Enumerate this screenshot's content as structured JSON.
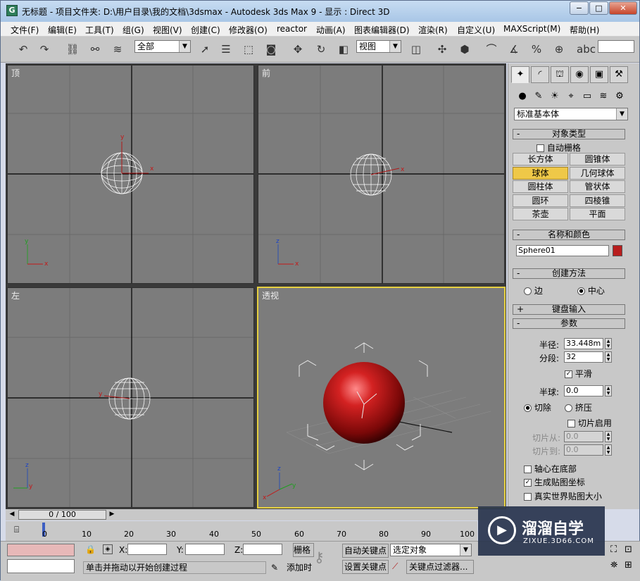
{
  "window": {
    "title": "无标题    - 项目文件夹: D:\\用户目录\\我的文档\\3dsmax      - Autodesk 3ds Max 9      - 显示 : Direct 3D",
    "controls": [
      "−",
      "□",
      "✕"
    ]
  },
  "menubar": {
    "items": [
      "文件(F)",
      "编辑(E)",
      "工具(T)",
      "组(G)",
      "视图(V)",
      "创建(C)",
      "修改器(O)",
      "reactor",
      "动画(A)",
      "图表编辑器(D)",
      "渲染(R)",
      "自定义(U)",
      "MAXScript(M)",
      "帮助(H)"
    ]
  },
  "toolbar": {
    "selection_filter": "全部",
    "reference_coord": "视图",
    "named_selection_placeholder": ""
  },
  "viewports": {
    "top": {
      "label": "顶",
      "axis_labels": {
        "x": "x",
        "y": "y"
      }
    },
    "front": {
      "label": "前",
      "axis_labels": {
        "x": "x",
        "z": "z"
      }
    },
    "left": {
      "label": "左",
      "axis_labels": {
        "y": "y",
        "z": "z"
      }
    },
    "perspective": {
      "label": "透视",
      "active": true,
      "axis_labels": {
        "x": "x",
        "y": "y",
        "z": "z"
      }
    }
  },
  "command_panel": {
    "category_dropdown": "标准基本体",
    "rollouts": {
      "object_type": {
        "title": "对象类型",
        "autogrid_label": "自动栅格",
        "buttons": [
          "长方体",
          "圆锥体",
          "球体",
          "几何球体",
          "圆柱体",
          "管状体",
          "圆环",
          "四棱锥",
          "茶壶",
          "平面"
        ],
        "active_button": "球体"
      },
      "name_color": {
        "title": "名称和颜色",
        "name": "Sphere01",
        "color": "#b81d1d"
      },
      "creation_method": {
        "title": "创建方法",
        "option_edge": "边",
        "option_center": "中心",
        "selected": "中心"
      },
      "keyboard_entry": {
        "title": "键盘输入"
      },
      "parameters": {
        "title": "参数",
        "radius_label": "半径:",
        "radius_value": "33.448m",
        "segments_label": "分段:",
        "segments_value": "32",
        "smooth_label": "平滑",
        "smooth_checked": true,
        "hemisphere_label": "半球:",
        "hemisphere_value": "0.0",
        "chop_label": "切除",
        "squash_label": "挤压",
        "slice_on_label": "切片启用",
        "slice_from_label": "切片从:",
        "slice_from_value": "0.0",
        "slice_to_label": "切片到:",
        "slice_to_value": "0.0",
        "base_to_pivot_label": "轴心在底部",
        "gen_mapping_label": "生成贴图坐标",
        "gen_mapping_checked": true,
        "real_world_label": "真实世界贴图大小"
      }
    }
  },
  "timeline": {
    "frame_display": "0 / 100",
    "ticks": [
      "0",
      "10",
      "20",
      "30",
      "40",
      "50",
      "60",
      "70",
      "80",
      "90",
      "100"
    ]
  },
  "status": {
    "prompt": "单击并拖动以开始创建过程",
    "coord_x_label": "X:",
    "coord_y_label": "Y:",
    "coord_z_label": "Z:",
    "grid_label": "栅格",
    "add_time_tag": "添加时",
    "auto_key": "自动关键点",
    "set_key": "设置关键点",
    "key_filters": "关键点过滤器...",
    "selected_dropdown": "选定对象"
  },
  "watermark": {
    "brand": "溜溜自学",
    "url": "ZIXUE.3D66.COM"
  }
}
